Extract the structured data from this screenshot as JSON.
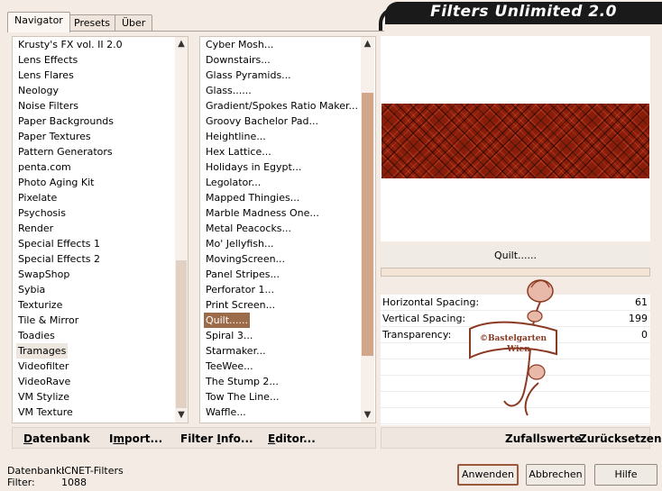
{
  "tabs": [
    "Navigator",
    "Presets",
    "Über"
  ],
  "title": "Filters Unlimited 2.0",
  "categories": [
    "Krusty's FX vol. II 2.0",
    "Lens Effects",
    "Lens Flares",
    "Neology",
    "Noise Filters",
    "Paper Backgrounds",
    "Paper Textures",
    "Pattern Generators",
    "penta.com",
    "Photo Aging Kit",
    "Pixelate",
    "Psychosis",
    "Render",
    "Special Effects 1",
    "Special Effects 2",
    "SwapShop",
    "Sybia",
    "Texturize",
    "Tile & Mirror",
    "Toadies",
    "Tramages",
    "Videofilter",
    "VideoRave",
    "VM Stylize",
    "VM Texture"
  ],
  "selected_category": "Tramages",
  "filters": [
    "Cyber Mosh...",
    "Downstairs...",
    "Glass Pyramids...",
    "Glass......",
    "Gradient/Spokes Ratio Maker...",
    "Groovy Bachelor Pad...",
    "Heightline...",
    "Hex Lattice...",
    "Holidays in Egypt...",
    "Legolator...",
    "Mapped Thingies...",
    "Marble Madness One...",
    "Metal Peacocks...",
    "Mo' Jellyfish...",
    "MovingScreen...",
    "Panel Stripes...",
    "Perforator 1...",
    "Print Screen...",
    "Quilt......",
    "Spiral 3...",
    "Starmaker...",
    "TeeWee...",
    "The Stump 2...",
    "Tow The Line...",
    "Waffle..."
  ],
  "selected_filter": "Quilt......",
  "filter_name": "Quilt......",
  "params": [
    {
      "label": "Horizontal Spacing:",
      "value": "61"
    },
    {
      "label": "Vertical Spacing:",
      "value": "199"
    },
    {
      "label": "Transparency:",
      "value": "0"
    }
  ],
  "left_buttons": {
    "datenbank": {
      "ul": "D",
      "rest": "atenbank"
    },
    "import": {
      "pre": "I",
      "ul": "m",
      "rest": "port..."
    },
    "filterinfo": {
      "pre": "Filter ",
      "ul": "I",
      "rest": "nfo..."
    },
    "editor": {
      "ul": "E",
      "rest": "ditor..."
    }
  },
  "right_buttons": {
    "zufall": "Zufallswerte",
    "zurueck": "Zurücksetzen"
  },
  "status": {
    "db_label": "Datenbank:",
    "db_value": "ICNET-Filters",
    "filter_label": "Filter:",
    "filter_value": "1088"
  },
  "dialog_buttons": {
    "apply": "Anwenden",
    "cancel": "Abbrechen",
    "help": "Hilfe"
  },
  "watermark": {
    "line1": "©Bastelgarten",
    "line2": "Wien"
  },
  "colors": {
    "accent": "#9b6b4a",
    "pattern": "#8a1d0a",
    "title_bg": "#1a1a1a"
  }
}
